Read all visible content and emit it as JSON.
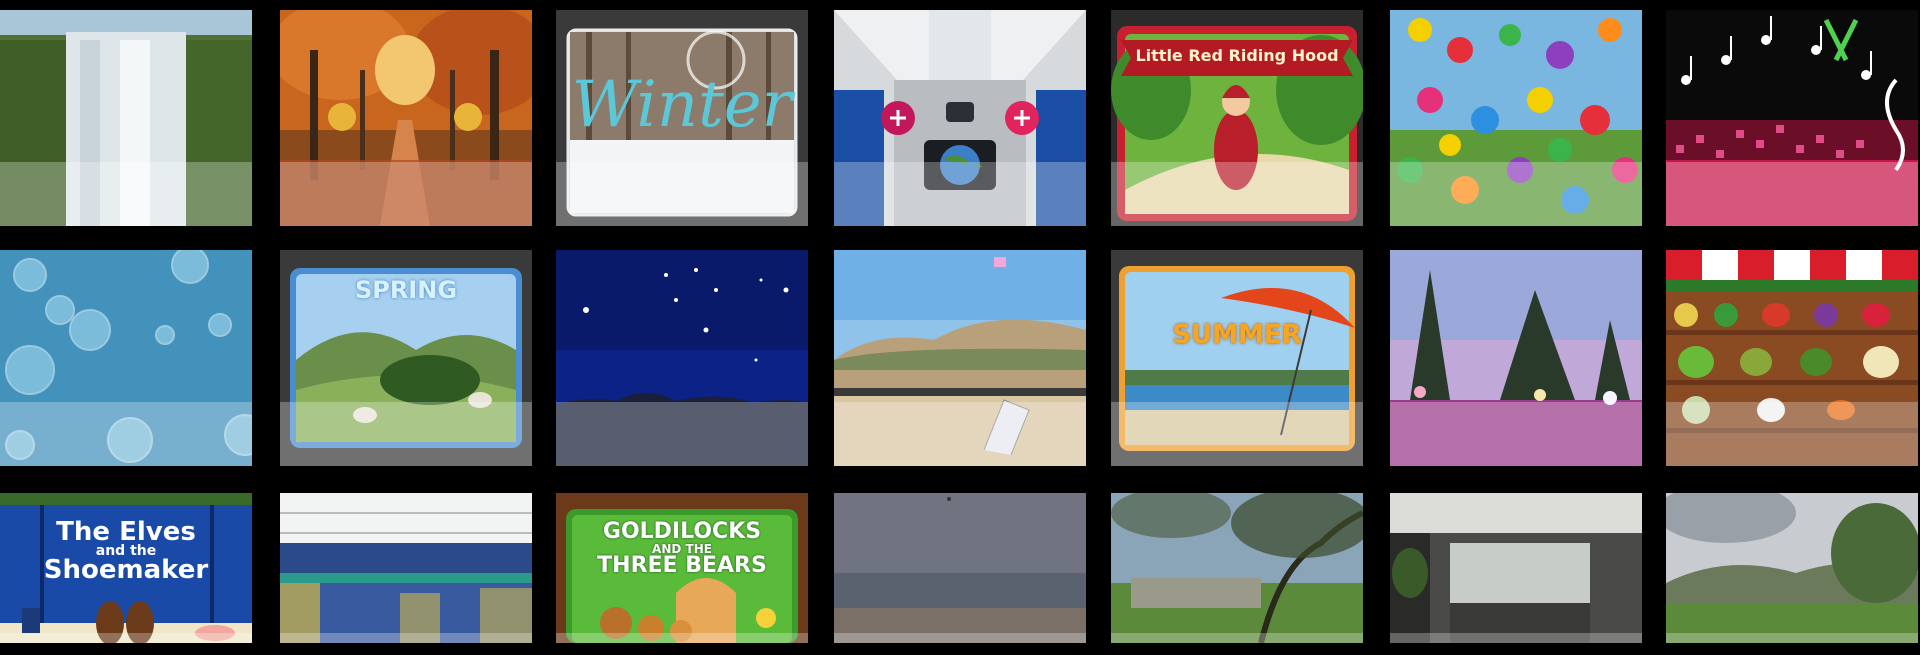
{
  "gallery": {
    "tiles": [
      {
        "name": "waterfall-tile"
      },
      {
        "name": "autumn-forest-tile"
      },
      {
        "name": "winter-tile",
        "title": "Winter"
      },
      {
        "name": "airplane-cabin-tile"
      },
      {
        "name": "little-red-riding-hood-tile",
        "title": "Little Red Riding Hood"
      },
      {
        "name": "colorful-letters-tile"
      },
      {
        "name": "music-notes-tile"
      },
      {
        "name": "bubbles-tile"
      },
      {
        "name": "spring-tile",
        "title": "SPRING"
      },
      {
        "name": "night-sky-tile"
      },
      {
        "name": "beach-tile"
      },
      {
        "name": "summer-tile",
        "title": "SUMMER"
      },
      {
        "name": "dusk-trees-tile"
      },
      {
        "name": "vegetable-market-tile"
      },
      {
        "name": "elves-and-shoemaker-tile",
        "title_line1": "The Elves",
        "title_line2": "and the",
        "title_line3": "Shoemaker"
      },
      {
        "name": "stadium-tile"
      },
      {
        "name": "goldilocks-tile",
        "title_line1": "GOLDILOCKS",
        "title_line2": "AND THE",
        "title_line3": "THREE BEARS"
      },
      {
        "name": "seascape-tile"
      },
      {
        "name": "country-house-tile"
      },
      {
        "name": "office-interior-tile"
      },
      {
        "name": "hills-landscape-tile"
      }
    ]
  },
  "colors": {
    "background": "#000000",
    "tile_shade": "rgba(255,255,255,0.28)"
  }
}
